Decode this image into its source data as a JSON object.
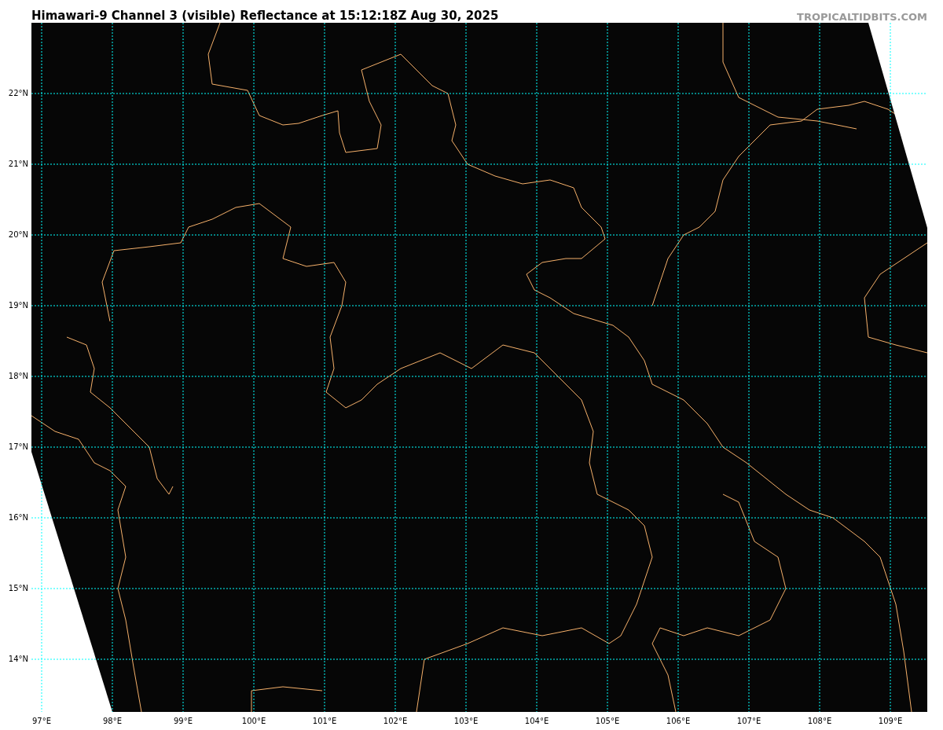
{
  "title": "Himawari-9 Channel 3 (visible) Reflectance at 15:12:18Z Aug 30, 2025",
  "credit": "TROPICALTIDBITS.COM",
  "map": {
    "lat_labels": [
      "22°N",
      "21°N",
      "20°N",
      "19°N",
      "18°N",
      "17°N",
      "16°N",
      "15°N",
      "14°N"
    ],
    "lon_labels": [
      "97°E",
      "98°E",
      "99°E",
      "100°E",
      "101°E",
      "102°E",
      "103°E",
      "104°E",
      "105°E",
      "106°E",
      "107°E",
      "108°E",
      "109°E"
    ]
  }
}
